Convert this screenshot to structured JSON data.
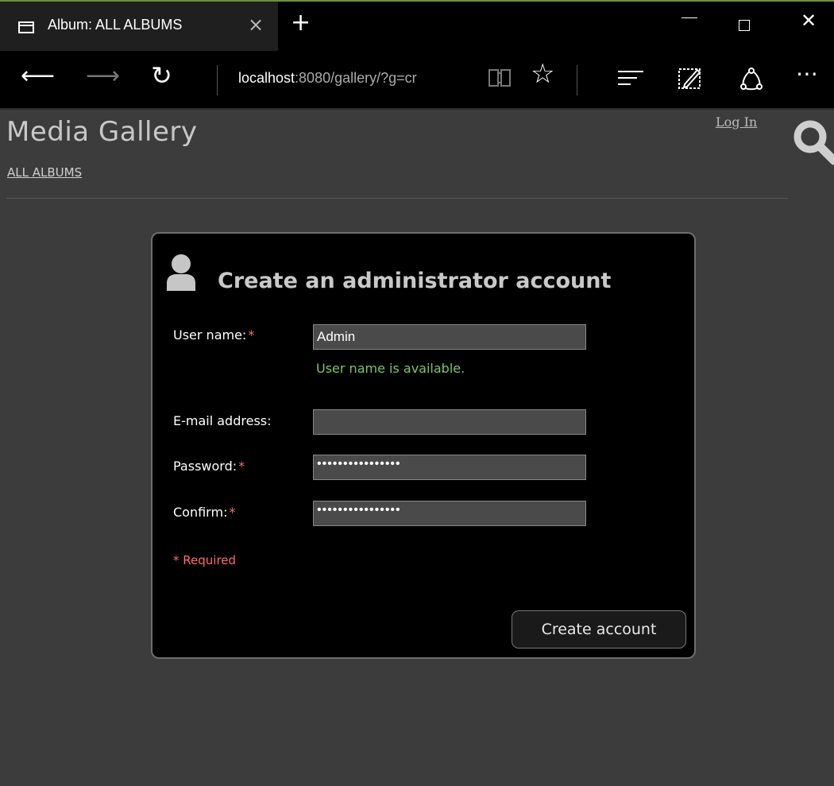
{
  "browser": {
    "tab_title": "Album: ALL ALBUMS",
    "tab_close": "×",
    "new_tab": "+",
    "address_host": "localhost",
    "address_rest": ":8080/gallery/?g=cr",
    "icons": [
      "tab-page-icon",
      "back-arrow-icon",
      "forward-arrow-icon",
      "refresh-icon",
      "reading-view-icon",
      "favorite-star-icon",
      "hub-icon",
      "web-note-icon",
      "share-icon",
      "more-icon"
    ]
  },
  "page": {
    "title": "Media Gallery",
    "breadcrumb": "ALL ALBUMS",
    "login_link": "Log In"
  },
  "dialog": {
    "title": "Create an administrator account",
    "fields": {
      "username": {
        "label": "User name:",
        "value": "Admin",
        "required": true
      },
      "email": {
        "label": "E-mail address:",
        "value": "",
        "required": false
      },
      "password": {
        "label": "Password:",
        "value": "••••••••••••••••",
        "required": true
      },
      "confirm": {
        "label": "Confirm:",
        "value": "••••••••••••••••",
        "required": true
      }
    },
    "required_marker": "*",
    "username_status": "User name is available.",
    "required_note": "* Required",
    "submit_label": "Create account"
  },
  "colors": {
    "page_bg": "#3c3c3c",
    "dialog_bg": "#000000",
    "required": "#ff6b6b",
    "success": "#7fc36b"
  }
}
